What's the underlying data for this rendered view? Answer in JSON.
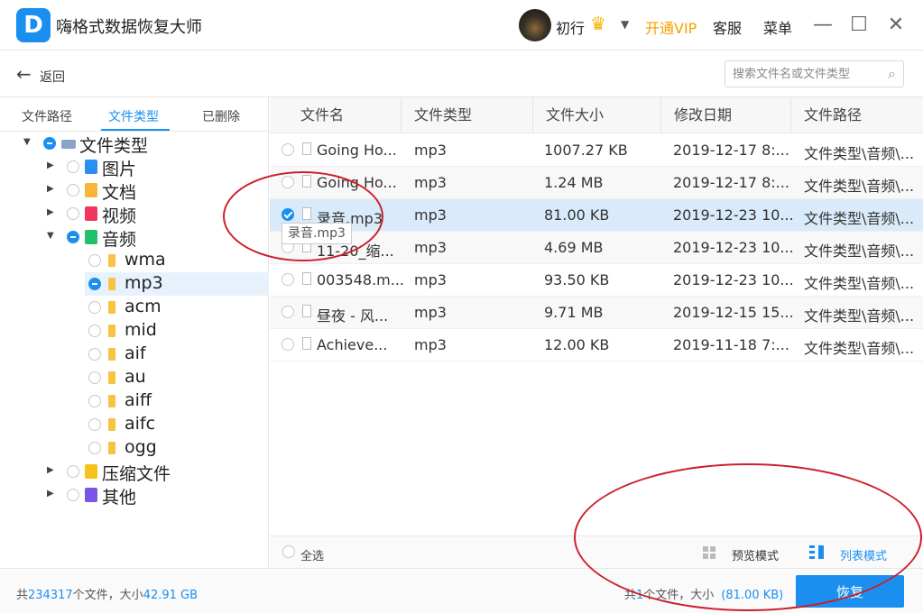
{
  "app": {
    "title": "嗨格式数据恢复大师",
    "logo_letter": "D",
    "username": "初行",
    "vip_label": "开通VIP",
    "service_label": "客服",
    "menu_label": "菜单",
    "accent_color": "#1a8ff0",
    "vip_color": "#f5a000"
  },
  "nav": {
    "back_label": "返回",
    "search_placeholder": "搜索文件名或文件类型"
  },
  "left_tabs": [
    {
      "label": "文件路径"
    },
    {
      "label": "文件类型"
    },
    {
      "label": "已删除"
    }
  ],
  "tree": {
    "root": "文件类型",
    "image": "图片",
    "doc": "文档",
    "video": "视频",
    "audio": "音频",
    "audio_children": [
      "wma",
      "mp3",
      "acm",
      "mid",
      "aif",
      "au",
      "aiff",
      "aifc",
      "ogg"
    ],
    "archive": "压缩文件",
    "other": "其他"
  },
  "table": {
    "columns": [
      "文件名",
      "文件类型",
      "文件大小",
      "修改日期",
      "文件路径"
    ],
    "rows": [
      {
        "name": "Going Ho...",
        "type": "mp3",
        "size": "1007.27 KB",
        "date": "2019-12-17 8:...",
        "path": "文件类型\\音频\\..."
      },
      {
        "name": "Going Ho...",
        "type": "mp3",
        "size": "1.24 MB",
        "date": "2019-12-17 8:...",
        "path": "文件类型\\音频\\..."
      },
      {
        "name": "录音.mp3",
        "type": "mp3",
        "size": "81.00 KB",
        "date": "2019-12-23 10...",
        "path": "文件类型\\音频\\..."
      },
      {
        "name": "11-20_缩...",
        "type": "mp3",
        "size": "4.69 MB",
        "date": "2019-12-23 10...",
        "path": "文件类型\\音频\\..."
      },
      {
        "name": "003548.m...",
        "type": "mp3",
        "size": "93.50 KB",
        "date": "2019-12-23 10...",
        "path": "文件类型\\音频\\..."
      },
      {
        "name": "昼夜 - 风...",
        "type": "mp3",
        "size": "9.71 MB",
        "date": "2019-12-15 15...",
        "path": "文件类型\\音频\\..."
      },
      {
        "name": "Achieve...",
        "type": "mp3",
        "size": "12.00 KB",
        "date": "2019-11-18 7:...",
        "path": "文件类型\\音频\\..."
      }
    ],
    "tooltip": "录音.mp3"
  },
  "footer": {
    "select_all": "全选",
    "preview_mode": "预览模式",
    "list_mode": "列表模式"
  },
  "status": {
    "total_prefix": "共",
    "total_count": "234317",
    "total_mid": "个文件，大小",
    "total_size": "42.91 GB",
    "sel_prefix": "共",
    "sel_count": "1",
    "sel_mid": "个文件，大小",
    "sel_size": "(81.00 KB)",
    "recover_label": "恢复"
  }
}
